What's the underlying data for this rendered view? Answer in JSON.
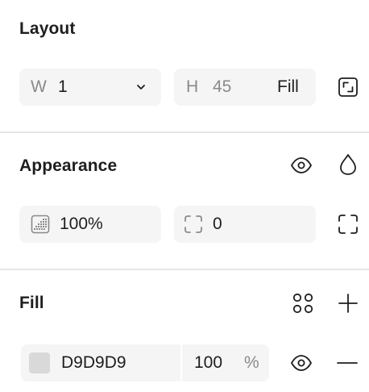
{
  "layout": {
    "title": "Layout",
    "width_label": "W",
    "width_value": "1",
    "height_label": "H",
    "height_value": "45",
    "height_mode": "Fill",
    "icons": {
      "width_dropdown": "chevron-down-icon",
      "resize_to_fit": "resize-to-fit-icon"
    }
  },
  "appearance": {
    "title": "Appearance",
    "opacity_value": "100%",
    "corner_radius_value": "0",
    "icons": {
      "visibility": "eye-icon",
      "blend_mode": "drop-icon",
      "opacity": "opacity-icon",
      "corner_radius": "corner-radius-icon",
      "independent_corners": "independent-corners-icon"
    }
  },
  "fill": {
    "title": "Fill",
    "color_hex": "D9D9D9",
    "swatch_color": "#D9D9D9",
    "opacity_value": "100",
    "opacity_unit": "%",
    "icons": {
      "styles": "styles-grid-icon",
      "add": "plus-icon",
      "visibility": "eye-icon",
      "remove": "minus-icon"
    }
  }
}
